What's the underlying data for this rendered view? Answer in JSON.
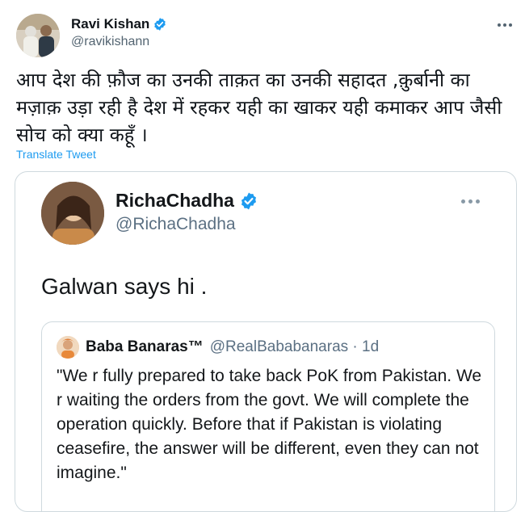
{
  "header": {
    "name": "Ravi Kishan",
    "handle": "@ravikishann",
    "more_icon": "more-horizontal-icon"
  },
  "tweet": {
    "text": "आप देश की फ़ौज का उनकी ताक़त का उनकी सहादत ,क़ुर्बानी का मज़ाक़ उड़ा रही है देश में रहकर यही का खाकर यही कमाकर आप जैसी सोच को क्या कहूँ ।",
    "translate_label": "Translate Tweet"
  },
  "quoted": {
    "name": "RichaChadha",
    "handle": "@RichaChadha",
    "text": "Galwan says hi .",
    "inner": {
      "name": "Baba Banaras™",
      "handle": "@RealBababanaras · 1d",
      "text": "\"We r fully prepared to take back PoK from Pakistan. We r waiting the orders from the govt. We will complete the operation quickly. Before that if Pakistan is violating ceasefire, the answer will be different, even they can not imagine.\""
    }
  },
  "colors": {
    "accent": "#1d9bf0",
    "verified": "#1d9bf0",
    "secondary_text": "#536471",
    "border": "#cfd9de"
  }
}
